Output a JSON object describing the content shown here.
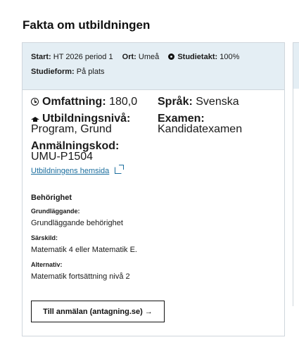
{
  "section_title": "Fakta om utbildningen",
  "summary": {
    "start_label": "Start:",
    "start_value": "HT 2026 period 1",
    "ort_label": "Ort:",
    "ort_value": "Umeå",
    "studietakt_label": "Studietakt:",
    "studietakt_value": "100%",
    "studieform_label": "Studieform:",
    "studieform_value": "På plats"
  },
  "facts": {
    "omfattning_label": "Omfattning:",
    "omfattning_value": "180,0",
    "utbildningsniva_label": "Utbildningsnivå:",
    "utbildningsniva_value": "Program, Grund",
    "anmalningskod_label": "Anmälningskod:",
    "anmalningskod_value": "UMU-P1504",
    "sprak_label": "Språk:",
    "sprak_value": "Svenska",
    "examen_label": "Examen:",
    "examen_value": "Kandidatexamen"
  },
  "homepage_link": "Utbildningens hemsida",
  "eligibility": {
    "title": "Behörighet",
    "items": [
      {
        "label": "Grundläggande:",
        "value": "Grundläggande behörighet"
      },
      {
        "label": "Särskild:",
        "value": "Matematik 4 eller Matematik E."
      },
      {
        "label": "Alternativ:",
        "value": "Matematik fortsättning nivå 2"
      }
    ]
  },
  "cta_label": "Till anmälan (antagning.se) →"
}
